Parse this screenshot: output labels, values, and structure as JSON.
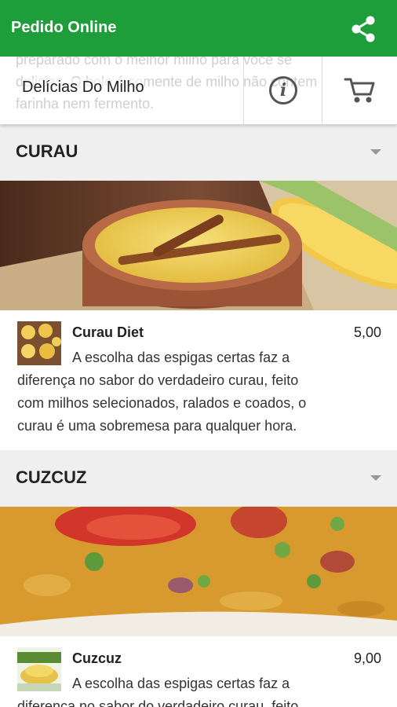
{
  "app_bar": {
    "title": "Pedido Online",
    "share_icon": "share-icon",
    "color": "#1e9e3a"
  },
  "shop": {
    "name": "Delícias Do Milho",
    "background_text": "preparado com o melhor milho para você se delicias. O bolo é somente de milho não contem farinha nem fermento.",
    "info_icon": "i",
    "cart_icon": "cart-icon"
  },
  "categories": [
    {
      "title": "CURAU",
      "items": [
        {
          "name": "Curau Diet",
          "price": "5,00",
          "description": "A escolha das espigas certas faz a diferença no sabor do verdadeiro curau, feito com milhos selecionados, ralados e coados, o curau é uma sobremesa para qualquer hora."
        }
      ]
    },
    {
      "title": "CUZCUZ",
      "items": [
        {
          "name": "Cuzcuz",
          "price": "9,00",
          "description": "A escolha das espigas certas faz a diferença no sabor do verdadeiro curau, feito com milhos selecionados, ralados e coados."
        }
      ]
    }
  ]
}
